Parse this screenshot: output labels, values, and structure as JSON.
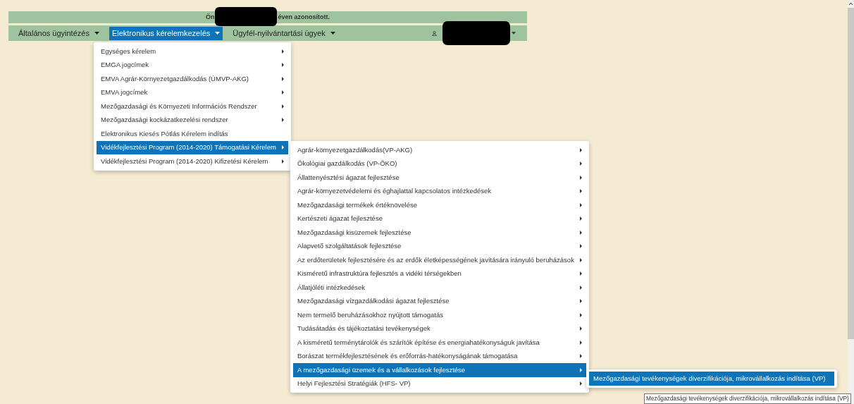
{
  "banner": {
    "before": "Ön",
    "after": "éven azonosított."
  },
  "nav": [
    {
      "label": "Általános ügyintézés",
      "selected": false
    },
    {
      "label": "Elektronikus kérelemkezelés",
      "selected": true
    },
    {
      "label": "Ügyfél-nyilvántartási ügyek",
      "selected": false
    }
  ],
  "menus": [
    {
      "items": [
        {
          "label": "Egységes kérelem",
          "selected": false,
          "submenu": true
        },
        {
          "label": "EMGA jogcímek",
          "selected": false,
          "submenu": true
        },
        {
          "label": "EMVA Agrár-Környezetgazdálkodás (ÚMVP-AKG)",
          "selected": false,
          "submenu": true
        },
        {
          "label": "EMVA jogcímek",
          "selected": false,
          "submenu": true
        },
        {
          "label": "Mezőgazdasági és Környezeti Információs Rendszer",
          "selected": false,
          "submenu": true
        },
        {
          "label": "Mezőgazdasági kockázatkezelési rendszer",
          "selected": false,
          "submenu": true
        },
        {
          "label": "Elektronikus Kiesés Pótlás Kérelem indítás",
          "selected": false,
          "submenu": false
        },
        {
          "label": "Vidékfejlesztési Program (2014-2020) Támogatási Kérelem",
          "selected": true,
          "submenu": true
        },
        {
          "label": "Vidékfejlesztési Program (2014-2020) Kifizetési Kérelem",
          "selected": false,
          "submenu": true
        }
      ]
    },
    {
      "items": [
        {
          "label": "Agrár-környezetgazdálkodás(VP-AKG)",
          "selected": false,
          "submenu": true
        },
        {
          "label": "Ökológiai gazdálkodás (VP-ÖKO)",
          "selected": false,
          "submenu": true
        },
        {
          "label": "Állattenyésztési ágazat fejlesztése",
          "selected": false,
          "submenu": true
        },
        {
          "label": "Agrár-környezetvédelemi és éghajlattal kapcsolatos intézkedések",
          "selected": false,
          "submenu": true
        },
        {
          "label": "Mezőgazdasági termékek értéknövelése",
          "selected": false,
          "submenu": true
        },
        {
          "label": "Kertészeti ágazat fejlesztése",
          "selected": false,
          "submenu": true
        },
        {
          "label": "Mezőgazdasági kisüzemek fejlesztése",
          "selected": false,
          "submenu": true
        },
        {
          "label": "Alapvető szolgáltatások fejlesztése",
          "selected": false,
          "submenu": true
        },
        {
          "label": "Az erdőterületek fejlesztésére és az erdők életképességének javítására irányuló beruházások",
          "selected": false,
          "submenu": true
        },
        {
          "label": "Kisméretű infrastruktúra fejlesztés a vidéki térségekben",
          "selected": false,
          "submenu": true
        },
        {
          "label": "Állatjóléti intézkedések",
          "selected": false,
          "submenu": true
        },
        {
          "label": "Mezőgazdasági vízgazdálkodási ágazat fejlesztése",
          "selected": false,
          "submenu": true
        },
        {
          "label": "Nem termelő beruházásokhoz nyújtott támogatás",
          "selected": false,
          "submenu": true
        },
        {
          "label": "Tudásátadás és tájékoztatási tevékenységek",
          "selected": false,
          "submenu": true
        },
        {
          "label": "A kisméretű terménytárolók és szárítók építése és energiahatékonyságuk javítása",
          "selected": false,
          "submenu": true
        },
        {
          "label": "Borászat termékfejlesztésének és erőforrás-hatékonyságának támogatása",
          "selected": false,
          "submenu": true
        },
        {
          "label": "A mezőgazdasági üzemek és a vállalkozások fejlesztése",
          "selected": true,
          "submenu": true
        },
        {
          "label": "Helyi Fejlesztési Stratégiák (HFS- VP)",
          "selected": false,
          "submenu": true
        }
      ]
    },
    {
      "items": [
        {
          "label": "Mezőgazdasági tevékenységek diverzifikációja, mikrovállalkozás indítása (VP)",
          "selected": true,
          "submenu": false
        }
      ]
    }
  ],
  "tooltip": "Mezőgazdasági tevékenységek diverzifikációja, mikrovállalkozás indítása (VP)"
}
